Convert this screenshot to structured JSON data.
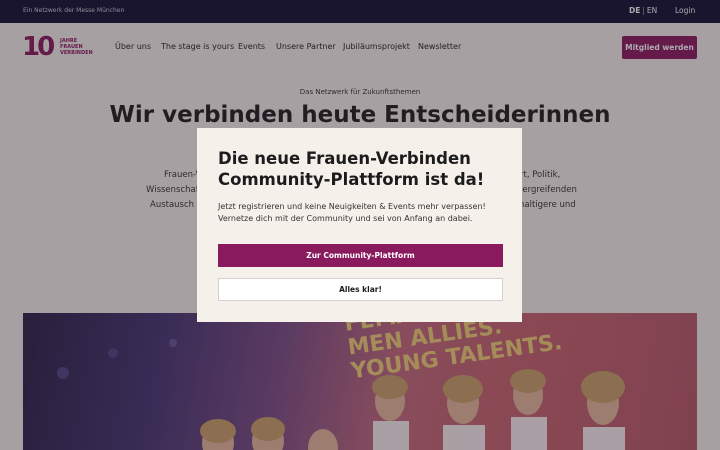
{
  "topbar": {
    "tagline": "Ein Netzwerk der Messe München",
    "lang_de": "DE",
    "lang_sep": "|",
    "lang_en": "EN",
    "login": "Login"
  },
  "logo": {
    "number": "10",
    "line1": "JAHRE",
    "line2": "FRAUEN",
    "line3": "VERBINDEN"
  },
  "nav": {
    "items": [
      "Über uns",
      "The stage is yours",
      "Events",
      "Unsere Partner",
      "Jubiläumsprojekt",
      "Newsletter"
    ],
    "cta": "Mitglied werden"
  },
  "hero": {
    "subtitle": "Das Netzwerk für Zukunftsthemen",
    "title": "Wir verbinden heute Entscheiderinnen",
    "text_lines_left": [
      "Frauen-V",
      "Wissenschaf",
      "Austausch zu"
    ],
    "text_lines_right": [
      "rt, Politik,",
      "bergreifenden",
      "haltigere und"
    ]
  },
  "photo": {
    "banner_line1": "FEMALE LEADERSHIP.",
    "banner_line2": "MEN ALLIES.",
    "banner_line3": "YOUNG TALENTS."
  },
  "modal": {
    "title": "Die neue Frauen-Verbinden Community-Plattform ist da!",
    "body": "Jetzt registrieren und keine Neuigkeiten & Events mehr verpassen! Vernetze dich mit der Community und sei von Anfang an dabei.",
    "primary_button": "Zur Community-Plattform",
    "secondary_button": "Alles klar!"
  },
  "colors": {
    "brand": "#8a1a5e",
    "topbar": "#131133",
    "background": "#f5f1ee"
  }
}
